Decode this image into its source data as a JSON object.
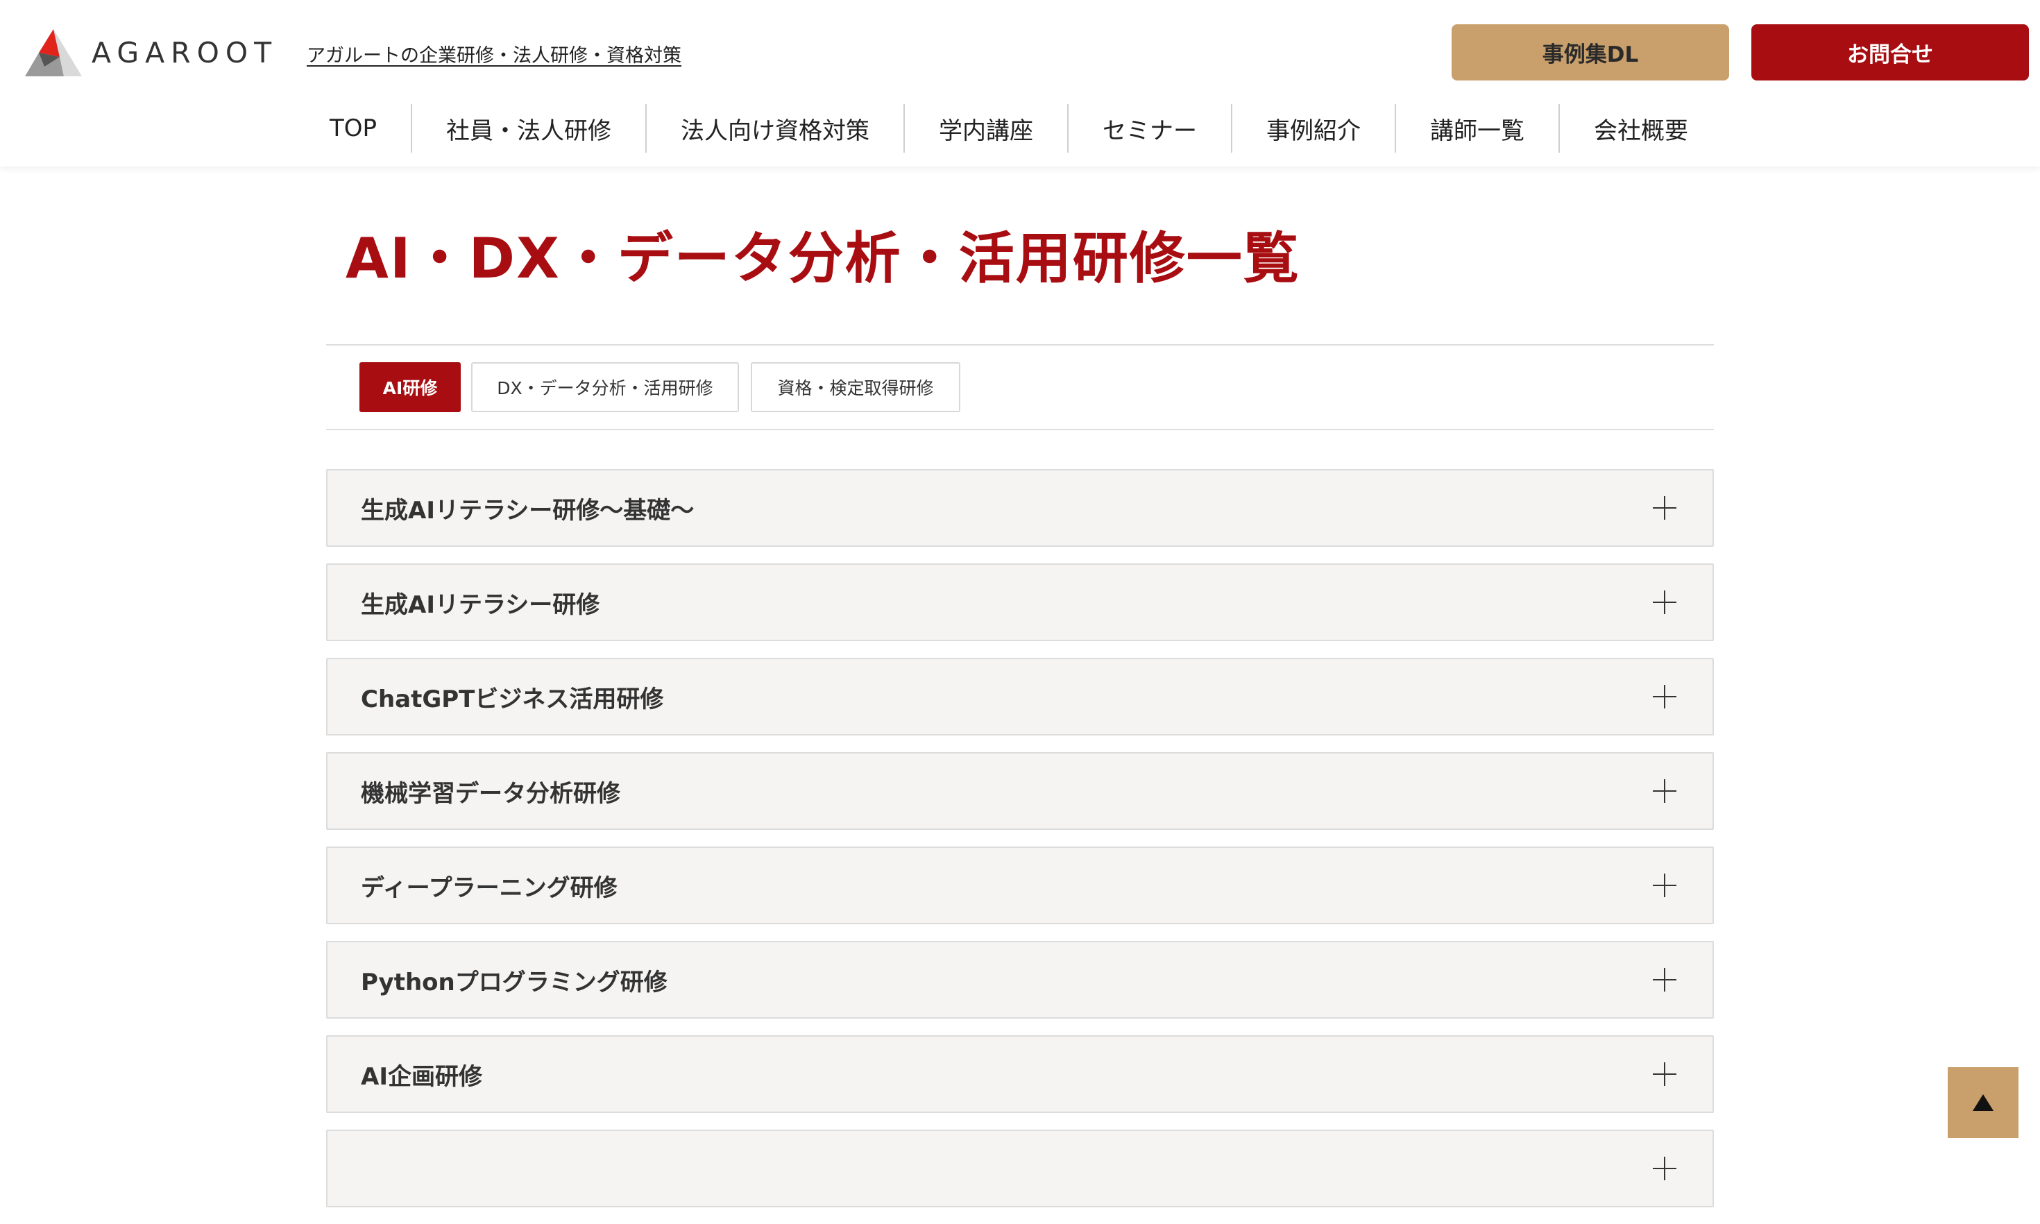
{
  "header": {
    "logo_text": "AGAROOT",
    "tagline": "アガルートの企業研修・法人研修・資格対策",
    "download_button": "事例集DL",
    "contact_button": "お問合せ",
    "colors": {
      "brand_red": "#a80d11",
      "gold": "#c9a06c"
    }
  },
  "nav": {
    "items": [
      {
        "label": "TOP"
      },
      {
        "label": "社員・法人研修"
      },
      {
        "label": "法人向け資格対策"
      },
      {
        "label": "学内講座"
      },
      {
        "label": "セミナー"
      },
      {
        "label": "事例紹介"
      },
      {
        "label": "講師一覧"
      },
      {
        "label": "会社概要"
      }
    ]
  },
  "main": {
    "title": "AI・DX・データ分析・活用研修一覧",
    "tabs": [
      {
        "label": "AI研修",
        "active": true
      },
      {
        "label": "DX・データ分析・活用研修",
        "active": false
      },
      {
        "label": "資格・検定取得研修",
        "active": false
      }
    ],
    "accordion": [
      {
        "label": "生成AIリテラシー研修〜基礎〜",
        "icon": "plus-icon"
      },
      {
        "label": "生成AIリテラシー研修",
        "icon": "plus-icon"
      },
      {
        "label": "ChatGPTビジネス活用研修",
        "icon": "plus-icon"
      },
      {
        "label": "機械学習データ分析研修",
        "icon": "plus-icon"
      },
      {
        "label": "ディープラーニング研修",
        "icon": "plus-icon"
      },
      {
        "label": "Pythonプログラミング研修",
        "icon": "plus-icon"
      },
      {
        "label": "AI企画研修",
        "icon": "plus-icon"
      },
      {
        "label": "",
        "icon": "plus-icon"
      }
    ]
  },
  "back_to_top": {
    "icon": "up-triangle-icon"
  }
}
